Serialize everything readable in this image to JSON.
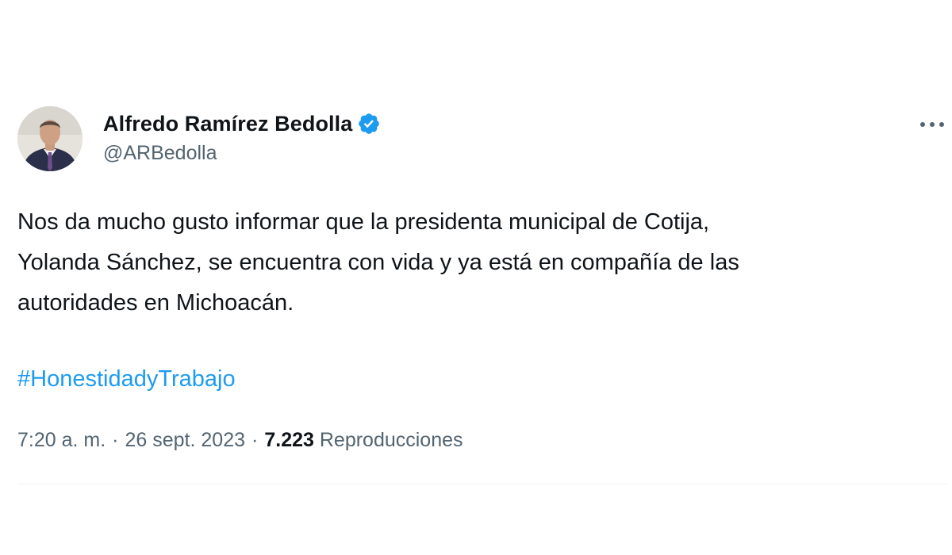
{
  "author": {
    "display_name": "Alfredo Ramírez Bedolla",
    "handle": "@ARBedolla",
    "verified_icon": "verified-badge-icon",
    "verified_color": "#1d9bf0"
  },
  "menu": {
    "icon": "more-options-icon"
  },
  "tweet": {
    "text": "Nos da mucho gusto informar que la presidenta municipal de Cotija,\nYolanda Sánchez, se encuentra con vida y ya está en compañía de las\nautoridades en Michoacán.",
    "hashtag": "#HonestidadyTrabajo"
  },
  "meta": {
    "time": "7:20 a. m.",
    "separator": "·",
    "date": "26 sept. 2023",
    "views_count": "7.223",
    "views_label": "Reproducciones"
  },
  "colors": {
    "text_primary": "#0f1419",
    "text_secondary": "#536471",
    "link": "#1d9bf0",
    "divider": "#eff3f4"
  }
}
